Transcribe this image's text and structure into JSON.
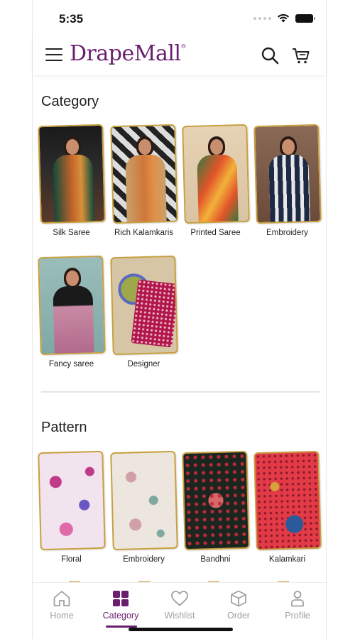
{
  "status_bar": {
    "time": "5:35"
  },
  "header": {
    "logo": "DrapeMall",
    "logo_mark": "®"
  },
  "sections": [
    {
      "title": "Category",
      "items": [
        {
          "label": "Silk Saree",
          "colors": [
            "#1a1a1a",
            "#c0622a",
            "#124a3a"
          ]
        },
        {
          "label": "Rich Kalamkaris",
          "colors": [
            "#222222",
            "#d0763a",
            "#c9a06a"
          ]
        },
        {
          "label": "Printed Saree",
          "colors": [
            "#d9c3a3",
            "#e2542a",
            "#2f7a3e"
          ]
        },
        {
          "label": "Embroidery",
          "colors": [
            "#6b4a3a",
            "#1c2a44",
            "#e8e8e8"
          ]
        },
        {
          "label": "Fancy saree",
          "colors": [
            "#7fa9a6",
            "#c98aa5",
            "#1a1a1a"
          ]
        },
        {
          "label": "Designer",
          "colors": [
            "#d6c6a6",
            "#b0164a",
            "#9ea84a"
          ]
        }
      ]
    },
    {
      "title": "Pattern",
      "items": [
        {
          "label": "Floral",
          "colors": [
            "#f2e4ee",
            "#c03a8a",
            "#6a56c0"
          ]
        },
        {
          "label": "Embroidery",
          "colors": [
            "#ece6df",
            "#d0a0a6",
            "#7ea8a0"
          ]
        },
        {
          "label": "Bandhni",
          "colors": [
            "#1c2620",
            "#c02a3a",
            "#d66a6a"
          ]
        },
        {
          "label": "Kalamkari",
          "colors": [
            "#e23a46",
            "#2a5a9a",
            "#d6a33a"
          ]
        }
      ]
    }
  ],
  "bottom_nav": [
    {
      "label": "Home",
      "icon": "home-icon",
      "active": false
    },
    {
      "label": "Category",
      "icon": "category-icon",
      "active": true
    },
    {
      "label": "Wishlist",
      "icon": "heart-icon",
      "active": false
    },
    {
      "label": "Order",
      "icon": "box-icon",
      "active": false
    },
    {
      "label": "Profile",
      "icon": "profile-icon",
      "active": false
    }
  ],
  "theme": {
    "brand": "#6a1e6e",
    "thumb_border": "#c8a040",
    "inactive": "#a0a0a0"
  }
}
